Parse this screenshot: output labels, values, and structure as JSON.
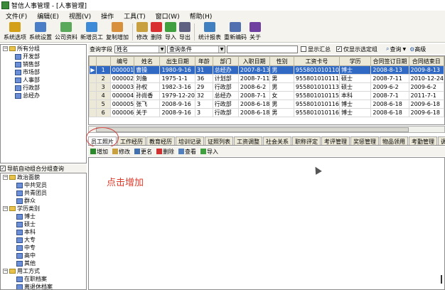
{
  "window": {
    "title": "智信人事管理 - [人事管理]"
  },
  "menu": [
    "文件(F)",
    "编辑(E)",
    "视图(V)",
    "操作",
    "工具(T)",
    "窗口(W)",
    "帮助(H)"
  ],
  "toolbar": [
    {
      "label": "系统选项",
      "icon": "wrench-icon",
      "color": "#d4a017"
    },
    {
      "label": "系统设置",
      "icon": "settings-icon",
      "color": "#4a7fc8"
    },
    {
      "label": "公司资料",
      "icon": "company-icon",
      "color": "#5aa85a"
    },
    {
      "label": "新增员工",
      "icon": "add-user-icon",
      "color": "#3c8ad8"
    },
    {
      "label": "复制增加",
      "icon": "copy-icon",
      "color": "#d8903c"
    },
    {
      "label": "修改",
      "icon": "edit-icon",
      "color": "#c8a040"
    },
    {
      "label": "删除",
      "icon": "delete-icon",
      "color": "#d83030"
    },
    {
      "label": "导入",
      "icon": "import-icon",
      "color": "#40a040"
    },
    {
      "label": "导出",
      "icon": "export-icon",
      "color": "#606080"
    },
    {
      "label": "统计报表",
      "icon": "report-icon",
      "color": "#4080c0"
    },
    {
      "label": "重新编码",
      "icon": "recode-icon",
      "color": "#5070b0"
    },
    {
      "label": "关于",
      "icon": "help-icon",
      "color": "#7040a0"
    }
  ],
  "left_tree": {
    "root": "所有分组",
    "items": [
      "开发部",
      "销售部",
      "市场部",
      "人事部",
      "行政部",
      "总经办"
    ]
  },
  "left_bottom": {
    "title": "导航自动组合分组查询",
    "groups": [
      {
        "name": "政治面貌",
        "items": [
          "中共党员",
          "共青团员",
          "群众"
        ]
      },
      {
        "name": "学历类别",
        "items": [
          "博士",
          "硕士",
          "本科",
          "大专",
          "中专",
          "高中",
          "其他"
        ]
      },
      {
        "name": "用工方式",
        "items": [
          "在职档案",
          "离退休档案",
          "其他档案"
        ]
      }
    ]
  },
  "query": {
    "field_label": "查询字段",
    "field_value": "姓名",
    "cond_label": "查询条件",
    "show_summary": "显示汇总",
    "only_selected": "仅显示选定组",
    "search_btn": "查询",
    "advanced_btn": "高级"
  },
  "grid": {
    "columns": [
      "编号",
      "姓名",
      "出生日期",
      "年龄",
      "部门",
      "入职日期",
      "性别",
      "工资卡号",
      "学历",
      "合同签订日期",
      "合同结束日"
    ],
    "rows": [
      [
        "000001",
        "曹操",
        "1980-9-16",
        "31",
        "总经办",
        "2007-8-13",
        "男",
        "955801010110",
        "博士",
        "2008-8-13",
        "2009-8-13"
      ],
      [
        "000002",
        "刘备",
        "1975-1-1",
        "36",
        "计划部",
        "2008-7-11",
        "男",
        "955801010111",
        "硕士",
        "2008-7-11",
        "2010-12-24"
      ],
      [
        "000003",
        "孙权",
        "1982-3-16",
        "29",
        "行政部",
        "2008-6-2",
        "男",
        "955801010113",
        "硕士",
        "2009-6-2",
        "2009-6-2"
      ],
      [
        "000004",
        "孙尚香",
        "1979-12-20",
        "32",
        "总经办",
        "2008-7-1",
        "女",
        "955801010115",
        "本科",
        "2008-7-1",
        "2011-7-1"
      ],
      [
        "000005",
        "张飞",
        "2008-9-16",
        "3",
        "行政部",
        "2008-6-18",
        "男",
        "955801010116",
        "博士",
        "2008-6-18",
        "2009-6-18"
      ],
      [
        "000006",
        "关于",
        "2008-9-16",
        "3",
        "行政部",
        "2008-6-18",
        "男",
        "955801010116",
        "博士",
        "2008-6-18",
        "2009-6-18"
      ]
    ]
  },
  "tabs": [
    "员工照片",
    "工作经历",
    "教育经历",
    "培训记录",
    "证照列表",
    "工资调整",
    "社会关系",
    "职称评定",
    "考评管理",
    "奖惩管理",
    "物品领用",
    "考勤管理",
    "调动管"
  ],
  "subtoolbar": [
    "增加",
    "修改",
    "更名",
    "删除",
    "查看",
    "导入"
  ],
  "hint": "点击增加"
}
